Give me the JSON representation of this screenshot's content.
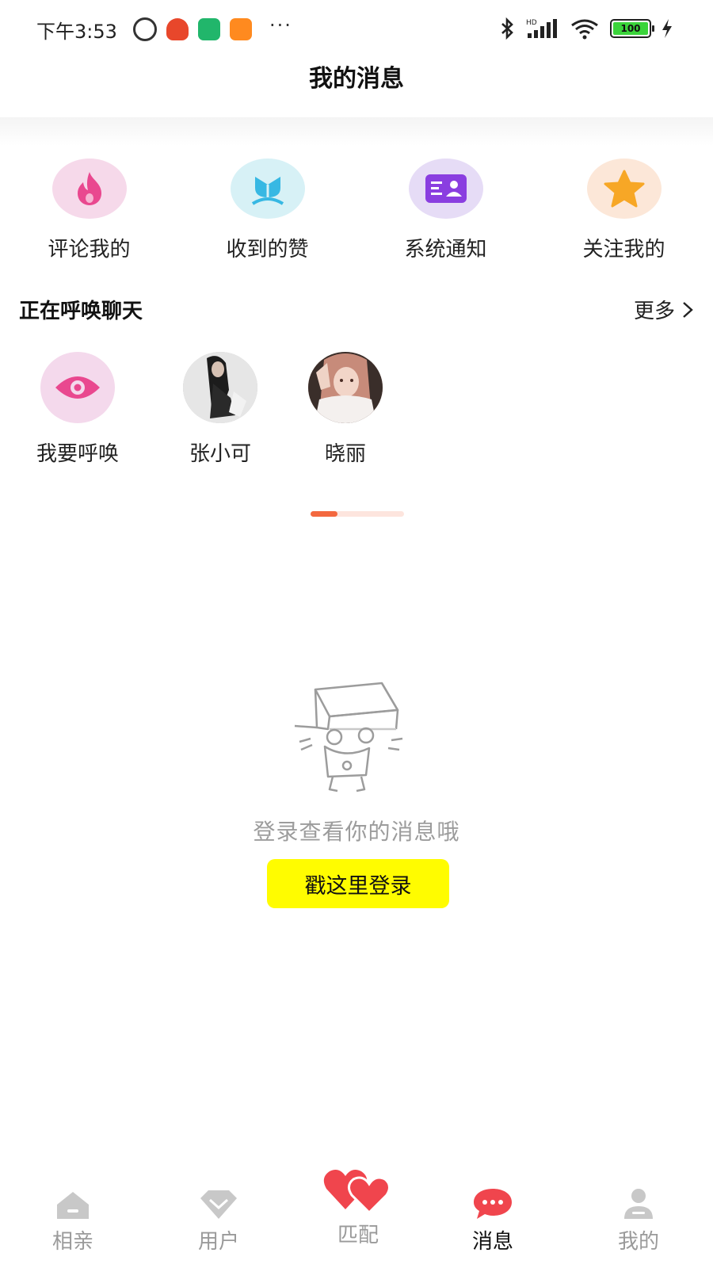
{
  "status_bar": {
    "time": "下午3:53",
    "dots": "···",
    "battery": "100"
  },
  "header": {
    "title": "我的消息"
  },
  "quick_entries": [
    {
      "label": "评论我的",
      "icon": "flame-icon",
      "color": "#e9488f",
      "bg": "#f6d9ea"
    },
    {
      "label": "收到的赞",
      "icon": "flower-icon",
      "color": "#37b8e3",
      "bg": "#d7f1f6"
    },
    {
      "label": "系统通知",
      "icon": "id-card-icon",
      "color": "#8a3ee0",
      "bg": "#e6dcf6"
    },
    {
      "label": "关注我的",
      "icon": "star-icon",
      "color": "#f7a726",
      "bg": "#fce7d8"
    }
  ],
  "calling": {
    "title": "正在呼唤聊天",
    "more": "更多",
    "items": [
      {
        "label": "我要呼唤",
        "icon": "eye-icon"
      },
      {
        "label": "张小可",
        "icon": "avatar"
      },
      {
        "label": "晓丽",
        "icon": "avatar"
      }
    ]
  },
  "empty_state": {
    "message": "登录查看你的消息哦",
    "login_button": "戳这里登录"
  },
  "tabs": [
    {
      "label": "相亲",
      "icon": "house-icon",
      "active": false
    },
    {
      "label": "用户",
      "icon": "diamond-icon",
      "active": false
    },
    {
      "label": "匹配",
      "icon": "hearts-icon",
      "active": false
    },
    {
      "label": "消息",
      "icon": "chat-bubble-icon",
      "active": true
    },
    {
      "label": "我的",
      "icon": "person-icon",
      "active": false
    }
  ],
  "colors": {
    "accent": "#f3683f",
    "login_button": "#fffc00",
    "chat_active": "#f0454d",
    "tab_inactive": "#c8c8c8"
  }
}
